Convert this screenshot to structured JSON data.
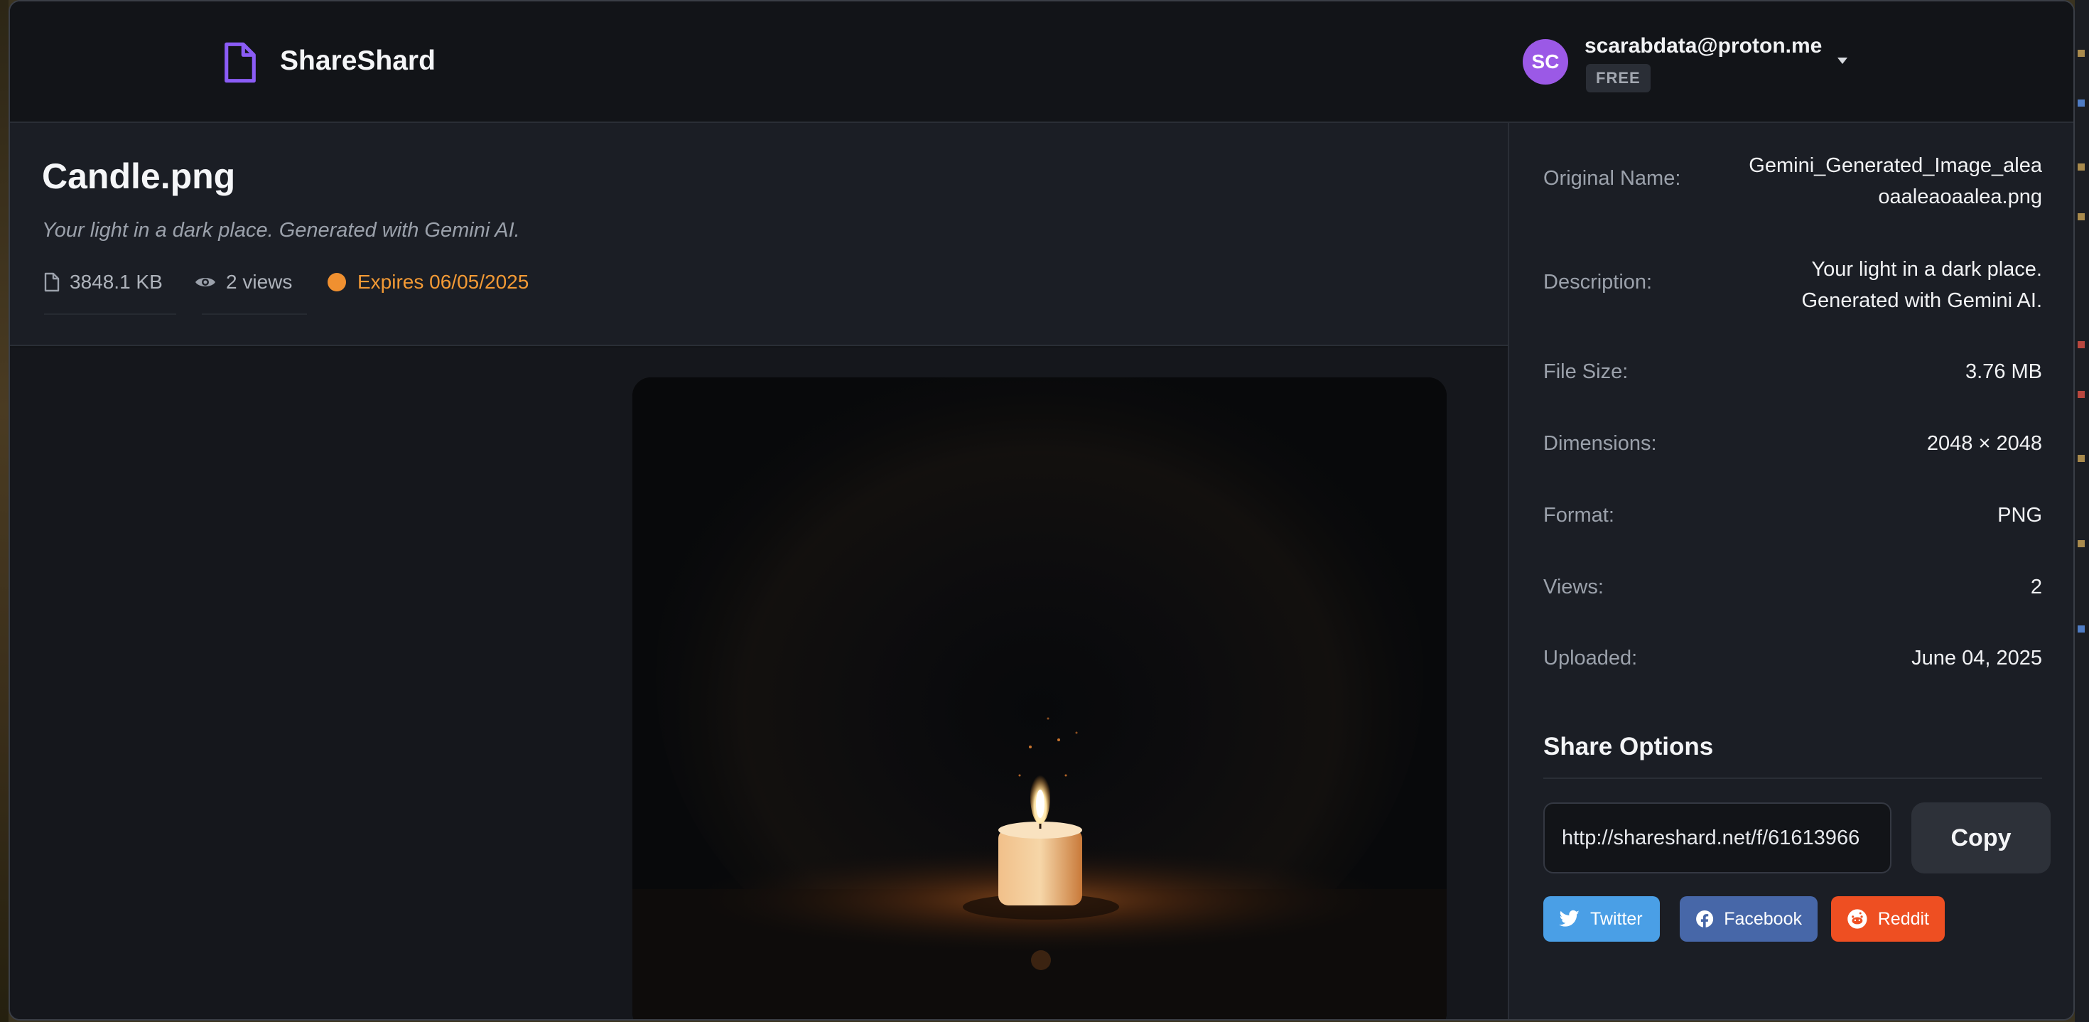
{
  "app": {
    "brand": "ShareShard"
  },
  "user": {
    "initials": "SC",
    "email": "scarabdata@proton.me",
    "plan": "FREE"
  },
  "file": {
    "title": "Candle.png",
    "description": "Your light in a dark place. Generated with Gemini AI.",
    "size": "3848.1 KB",
    "views": "2 views",
    "expires": "Expires 06/05/2025"
  },
  "details": {
    "original_name_label": "Original Name:",
    "original_name_line1": "Gemini_Generated_Image_alea",
    "original_name_line2": "oaaleaoaalea.png",
    "description_label": "Description:",
    "description_line1": "Your light in a dark place.",
    "description_line2": "Generated with Gemini AI.",
    "file_size_label": "File Size:",
    "file_size": "3.76 MB",
    "dimensions_label": "Dimensions:",
    "dimensions": "2048 × 2048",
    "format_label": "Format:",
    "format": "PNG",
    "views_label": "Views:",
    "views": "2",
    "uploaded_label": "Uploaded:",
    "uploaded": "June 04, 2025"
  },
  "share": {
    "title": "Share Options",
    "link": "http://shareshard.net/f/61613966",
    "copy_label": "Copy",
    "twitter": "Twitter",
    "facebook": "Facebook",
    "reddit": "Reddit"
  },
  "colors": {
    "accent": "#8b5cf6",
    "expires": "#f39a35",
    "twitter": "#4a9fe6",
    "facebook": "#4767a8",
    "reddit": "#ee4f22"
  }
}
